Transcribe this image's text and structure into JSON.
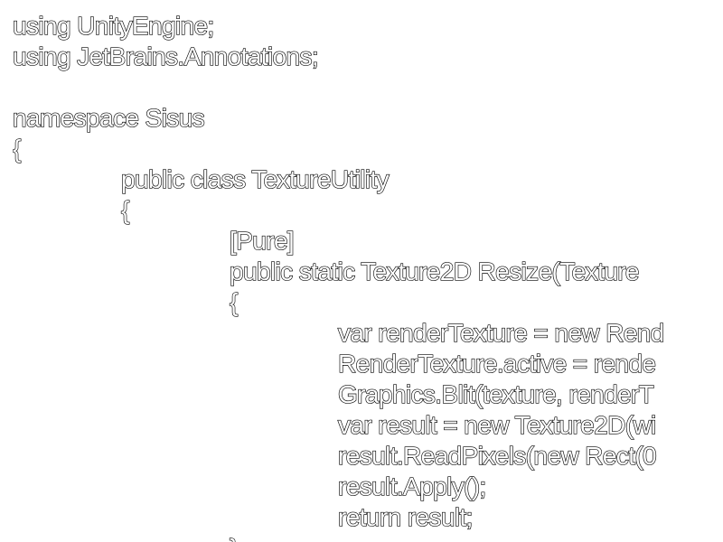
{
  "colors": {
    "background": "#ffffff",
    "text_fill": "#ffffff",
    "text_outline": "#000000"
  },
  "code": {
    "lines": [
      {
        "indent": 0,
        "text": "using UnityEngine;"
      },
      {
        "indent": 0,
        "text": "using JetBrains.Annotations;"
      },
      {
        "indent": 0,
        "text": ""
      },
      {
        "indent": 0,
        "text": "namespace Sisus"
      },
      {
        "indent": 0,
        "text": "{"
      },
      {
        "indent": 1,
        "text": "public class TextureUtility"
      },
      {
        "indent": 1,
        "text": "{"
      },
      {
        "indent": 2,
        "text": "[Pure]"
      },
      {
        "indent": 2,
        "text": "public static Texture2D Resize(Texture"
      },
      {
        "indent": 2,
        "text": "{"
      },
      {
        "indent": 3,
        "text": "var renderTexture = new Rend"
      },
      {
        "indent": 3,
        "text": "RenderTexture.active = rende"
      },
      {
        "indent": 3,
        "text": "Graphics.Blit(texture, renderT"
      },
      {
        "indent": 3,
        "text": "var result = new Texture2D(wi"
      },
      {
        "indent": 3,
        "text": "result.ReadPixels(new Rect(0"
      },
      {
        "indent": 3,
        "text": "result.Apply();"
      },
      {
        "indent": 3,
        "text": "return result;"
      },
      {
        "indent": 2,
        "text": "}"
      }
    ]
  }
}
